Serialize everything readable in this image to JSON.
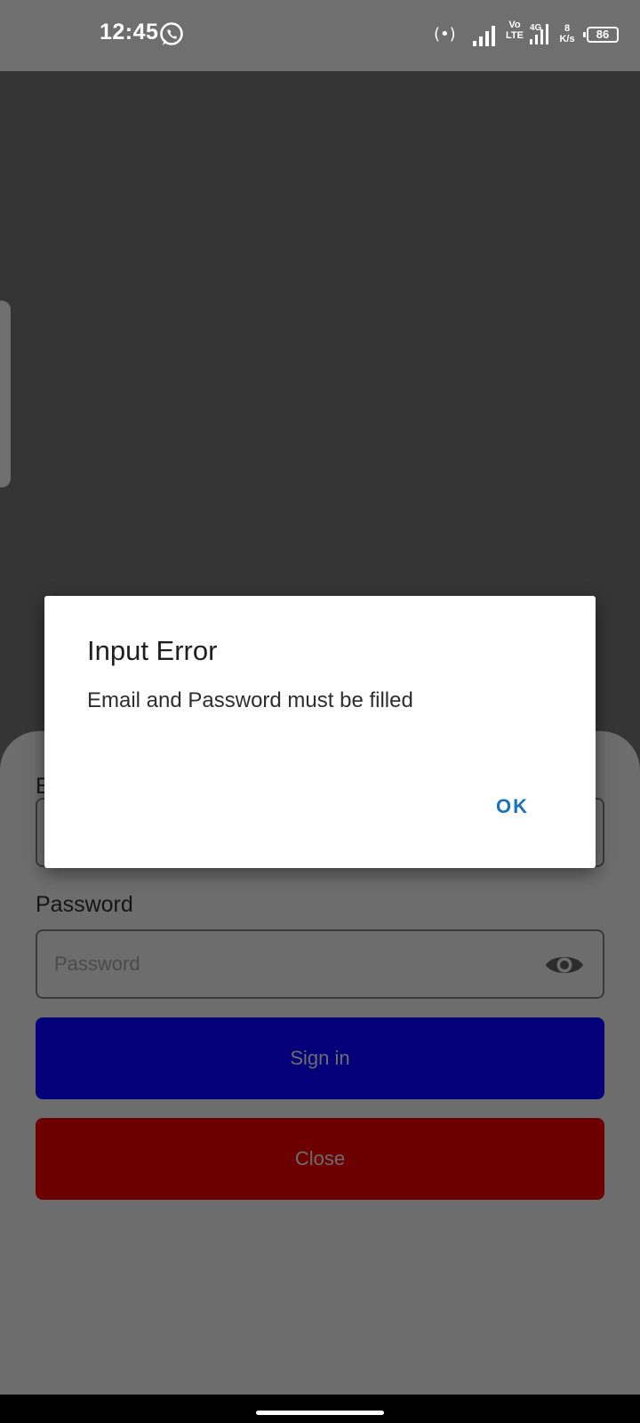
{
  "status_bar": {
    "time": "12:45",
    "volte_top": "Vo",
    "volte_bottom": "LTE",
    "network_type": "4G",
    "speed_value": "8",
    "speed_unit": "K/s",
    "battery_level": "86"
  },
  "form": {
    "email_label_partial": "E",
    "password_label": "Password",
    "password_placeholder": "Password",
    "sign_in_label": "Sign in",
    "close_label": "Close"
  },
  "dialog": {
    "title": "Input Error",
    "message": "Email and Password must be filled",
    "ok_label": "OK"
  },
  "colors": {
    "sign_in_button": "#03007a",
    "close_button": "#6c0000",
    "dialog_action": "#1a72b8"
  }
}
